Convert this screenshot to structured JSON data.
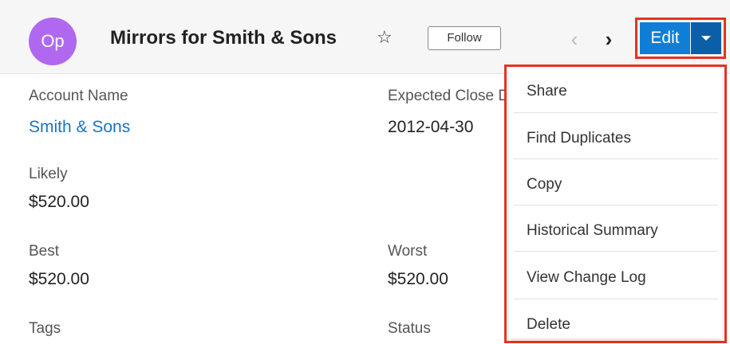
{
  "header": {
    "avatar_text": "Op",
    "title": "Mirrors for Smith & Sons",
    "follow_label": "Follow",
    "edit_label": "Edit"
  },
  "fields": {
    "account_name": {
      "label": "Account Name",
      "value": "Smith & Sons"
    },
    "expected_close": {
      "label": "Expected Close D",
      "value": "2012-04-30"
    },
    "likely": {
      "label": "Likely",
      "value": "$520.00"
    },
    "best": {
      "label": "Best",
      "value": "$520.00"
    },
    "worst": {
      "label": "Worst",
      "value": "$520.00"
    },
    "tags": {
      "label": "Tags"
    },
    "status": {
      "label": "Status"
    }
  },
  "menu": {
    "items": [
      {
        "label": "Share"
      },
      {
        "label": "Find Duplicates"
      },
      {
        "label": "Copy"
      },
      {
        "label": "Historical Summary"
      },
      {
        "label": "View Change Log"
      },
      {
        "label": "Delete"
      }
    ]
  },
  "colors": {
    "accent": "#0f7ed6",
    "highlight_box": "#e8331e",
    "avatar": "#b168f0",
    "link": "#1a73c4"
  },
  "icons": {
    "favorite": "star-outline-icon",
    "previous": "chevron-left-icon",
    "next": "chevron-right-icon",
    "actions": "caret-down-icon"
  }
}
